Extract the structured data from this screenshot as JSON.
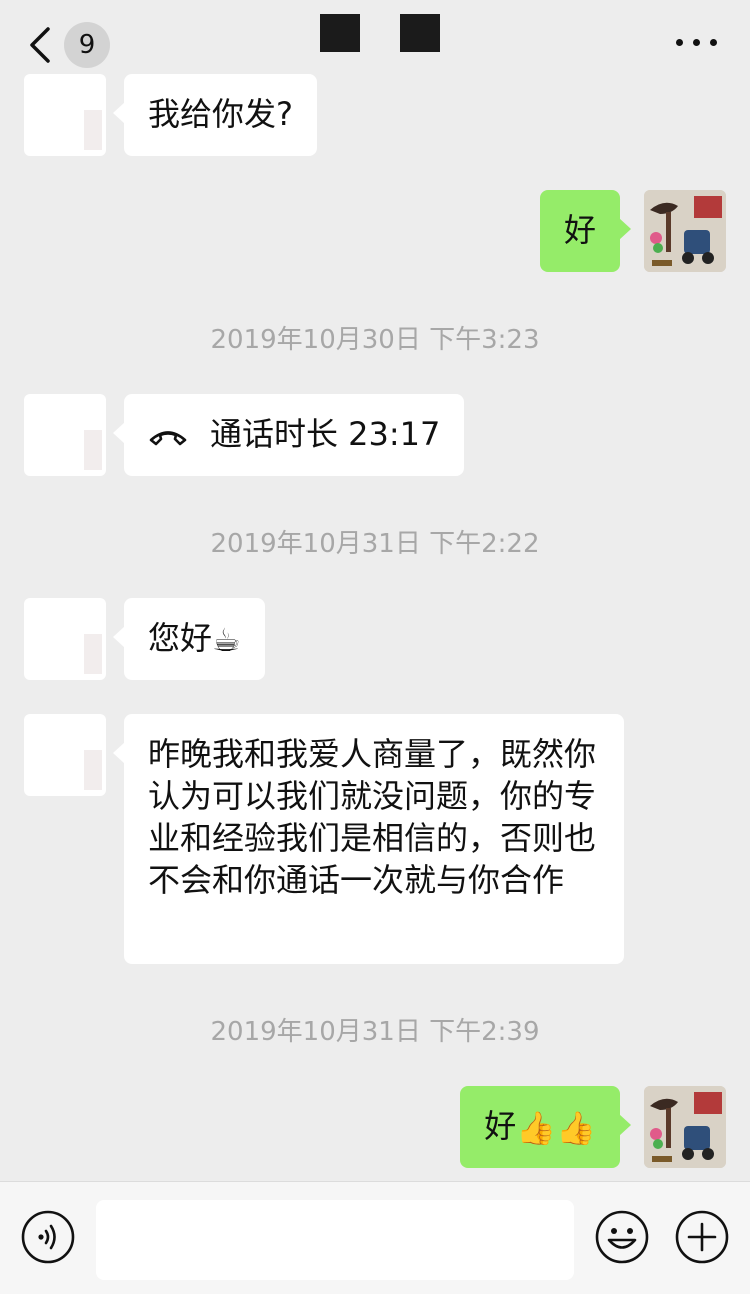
{
  "header": {
    "unread_count": "9",
    "back_icon": "chevron-left-icon",
    "more_icon": "more-horizontal-icon"
  },
  "messages": [
    {
      "side": "in",
      "text": "我给你发?"
    },
    {
      "side": "out",
      "text": "好"
    },
    {
      "type": "timestamp",
      "text": "2019年10月30日 下午3:23"
    },
    {
      "side": "in",
      "type": "call",
      "icon": "phone-hangup-icon",
      "text": "通话时长 23:17"
    },
    {
      "type": "timestamp",
      "text": "2019年10月31日 下午2:22"
    },
    {
      "side": "in",
      "text": "您好",
      "emoji": "☕"
    },
    {
      "side": "in",
      "text": "昨晚我和我爱人商量了，既然你认为可以我们就没问题，你的专业和经验我们是相信的，否则也不会和你通话一次就与你合作"
    },
    {
      "type": "timestamp",
      "text": "2019年10月31日 下午2:39"
    },
    {
      "side": "out",
      "text": "好",
      "emoji": "👍👍"
    }
  ],
  "input_bar": {
    "voice_icon": "voice-icon",
    "emoji_icon": "emoji-face-icon",
    "plus_icon": "plus-circle-icon",
    "input_value": ""
  },
  "colors": {
    "background": "#ededed",
    "bubble_out": "#95ec69",
    "bubble_in": "#ffffff",
    "timestamp": "#a7a7a7"
  }
}
